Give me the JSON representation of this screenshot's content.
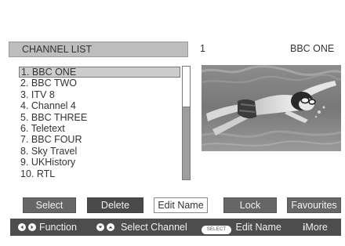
{
  "header": {
    "title": "CHANNEL LIST",
    "channel_number": "1",
    "channel_name": "BBC ONE"
  },
  "channels": [
    "1. BBC ONE",
    "2. BBC TWO",
    "3. ITV 8",
    "4. Channel 4",
    "5. BBC THREE",
    "6. Teletext",
    "7. BBC FOUR",
    "8. Sky Travel",
    "9. UKHistory",
    "10. RTL"
  ],
  "selected_channel_index": 0,
  "preview": {
    "icon": "swimmer-preview-image"
  },
  "buttons": {
    "select": "Select",
    "delete": "Delete",
    "edit_name": "Edit Name",
    "lock": "Lock",
    "favourites": "Favourites"
  },
  "help": {
    "function_label": "Function",
    "select_channel_label": "Select Channel",
    "select_key": "SELECT",
    "edit_name_label": "Edit Name",
    "more_label": "More",
    "icons": [
      "left-right-arrows-icon",
      "down-up-arrows-icon",
      "select-key-icon",
      "info-icon"
    ]
  },
  "colors": {
    "header_bar": "#bdbdbd",
    "selected_row": "#cccccc",
    "button_dark": "#666666",
    "button_darker": "#4a4a4a",
    "help_bar": "#4d4d4d"
  }
}
